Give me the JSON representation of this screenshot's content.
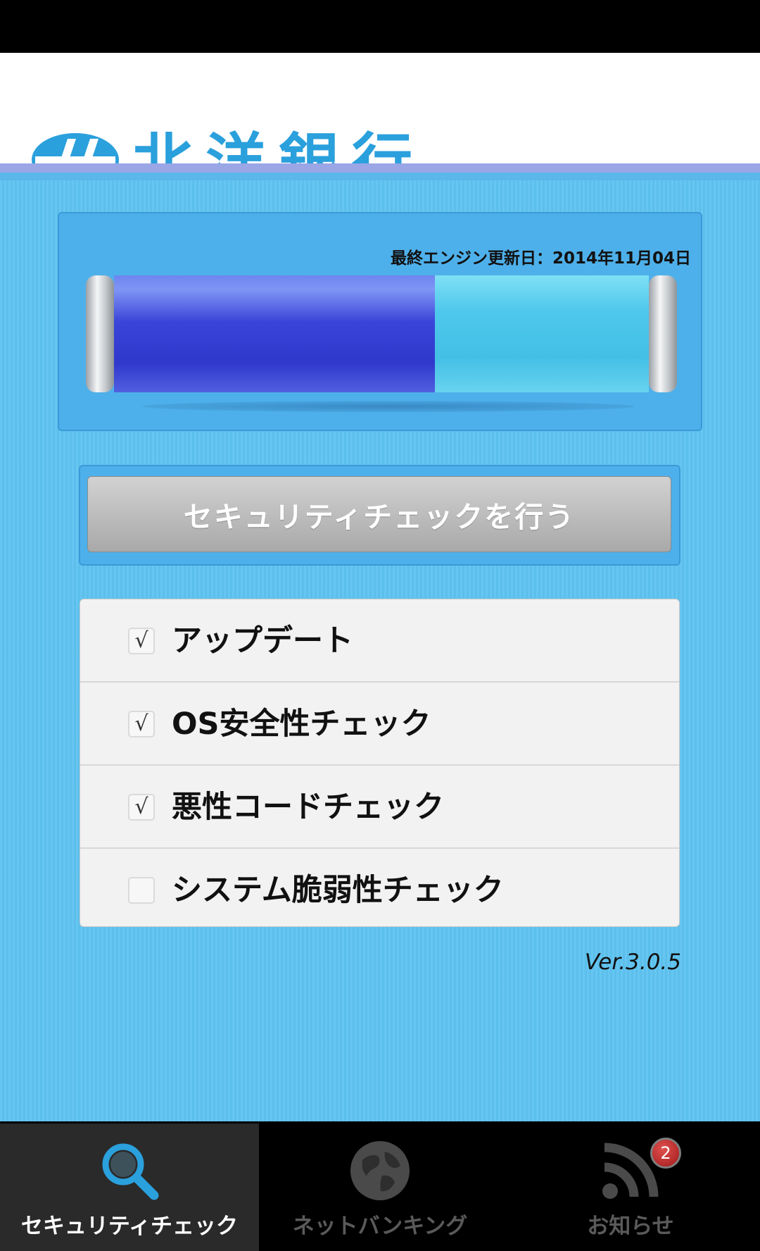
{
  "header": {
    "bank_name": "北洋銀行",
    "logo_icon": "hokuyo-bank-logo-icon"
  },
  "engine": {
    "last_update_text": "最終エンジン更新日：2014年11月04日",
    "progress_fraction": 0.6
  },
  "actions": {
    "security_check_label": "セキュリティチェックを行う"
  },
  "checklist": {
    "items": [
      {
        "label": "アップデート",
        "checked": true
      },
      {
        "label": "OS安全性チェック",
        "checked": true
      },
      {
        "label": "悪性コードチェック",
        "checked": true
      },
      {
        "label": "システム脆弱性チェック",
        "checked": false
      }
    ]
  },
  "version": "Ver.3.0.5",
  "tabs": [
    {
      "label": "セキュリティチェック",
      "icon": "search-icon",
      "active": true
    },
    {
      "label": "ネットバンキング",
      "icon": "globe-icon",
      "active": false
    },
    {
      "label": "お知らせ",
      "icon": "rss-icon",
      "active": false,
      "badge": "2"
    }
  ],
  "colors": {
    "brand_blue": "#2aa0dc",
    "background": "#5ec3f0",
    "progress_fill": "#3038cc"
  }
}
